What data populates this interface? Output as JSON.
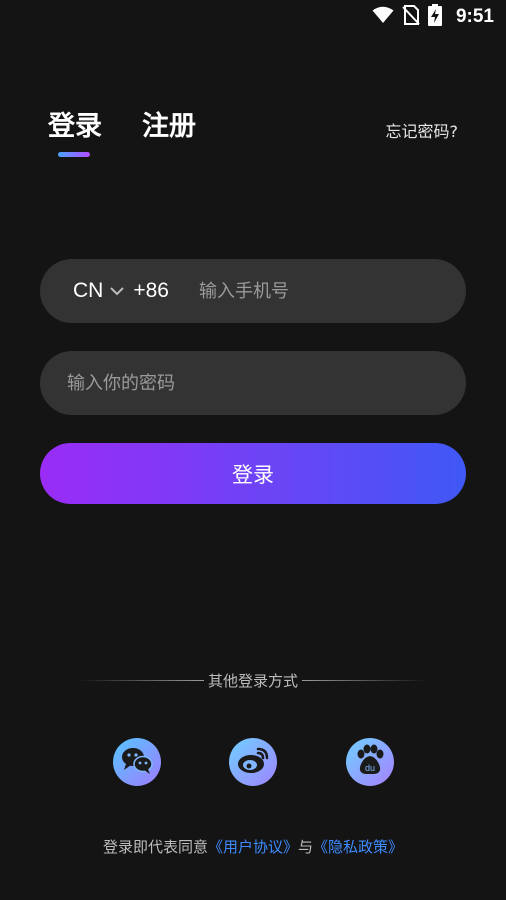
{
  "status_bar": {
    "time": "9:51",
    "icons": [
      "wifi-icon",
      "no-sim-icon",
      "battery-charging-icon"
    ]
  },
  "tabs": [
    {
      "label": "登录",
      "active": true
    },
    {
      "label": "注册",
      "active": false
    }
  ],
  "forgot_password": "忘记密码?",
  "phone_field": {
    "country_code": "CN",
    "dial_code": "+86",
    "placeholder": "输入手机号"
  },
  "password_field": {
    "placeholder": "输入你的密码"
  },
  "login_button": "登录",
  "other_login": {
    "label": "其他登录方式",
    "providers": [
      "wechat-icon",
      "weibo-icon",
      "baidu-icon"
    ]
  },
  "agreement": {
    "prefix": "登录即代表同意",
    "user_agreement": "《用户协议》",
    "conjunction": "与",
    "privacy_policy": "《隐私政策》"
  },
  "colors": {
    "background": "#141414",
    "field": "#333333",
    "button_start": "#9a2cf5",
    "button_end": "#3f58f5",
    "link": "#3d8bff"
  }
}
